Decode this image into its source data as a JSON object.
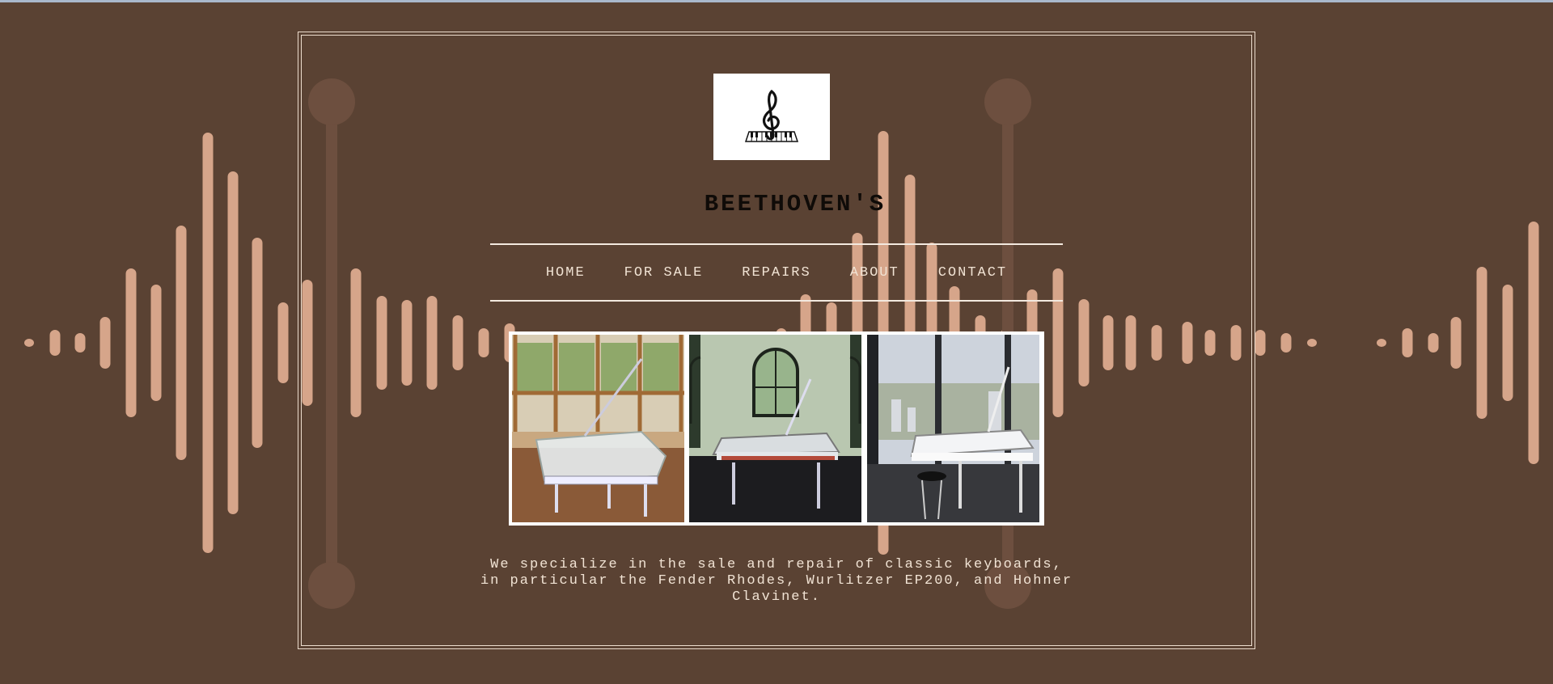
{
  "site": {
    "brand": "BEETHOVEN'S",
    "logo": "treble-clef-piano-logo"
  },
  "nav": {
    "items": [
      {
        "label": "HOME"
      },
      {
        "label": "FOR SALE"
      },
      {
        "label": "REPAIRS"
      },
      {
        "label": "ABOUT"
      },
      {
        "label": "CONTACT"
      }
    ]
  },
  "gallery": {
    "photos": [
      {
        "name": "clear-grand-piano-window-room"
      },
      {
        "name": "clear-grand-piano-arched-windows"
      },
      {
        "name": "white-grand-piano-city-view"
      }
    ]
  },
  "intro": {
    "text": "We specialize in the sale and repair of classic keyboards, in particular the Fender Rhodes, Wurlitzer EP200, and Hohner Clavinet."
  },
  "colors": {
    "background": "#5a4233",
    "wave_bars": "#d6a58a",
    "text_light": "#f1e3d4",
    "brand_text": "#0f0b08"
  }
}
